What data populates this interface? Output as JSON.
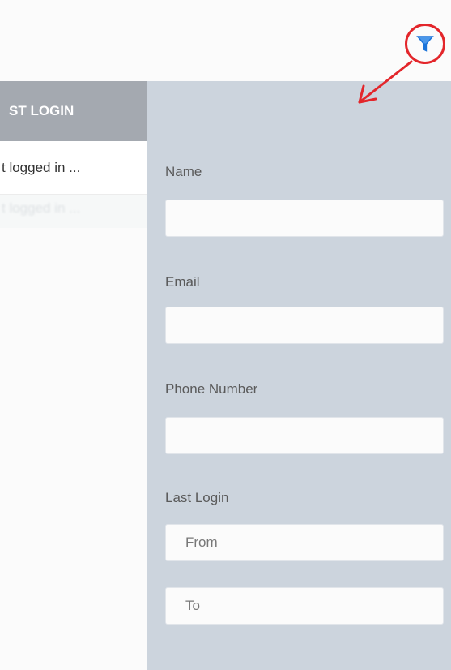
{
  "table": {
    "header_label": "ST LOGIN",
    "rows": [
      {
        "last_login": "t logged in ..."
      },
      {
        "last_login": "t logged in ..."
      }
    ]
  },
  "filter_panel": {
    "fields": [
      {
        "label": "Name",
        "value": "",
        "placeholder": ""
      },
      {
        "label": "Email",
        "value": "",
        "placeholder": ""
      },
      {
        "label": "Phone Number",
        "value": "",
        "placeholder": ""
      }
    ],
    "last_login": {
      "label": "Last Login",
      "from_placeholder": "From",
      "to_placeholder": "To"
    }
  },
  "icons": {
    "filter": "filter-icon",
    "annotation_circle": "red-circle-highlight",
    "annotation_arrow": "red-arrow"
  },
  "colors": {
    "filter_icon": "#1a73d9",
    "annotation": "#e3262b",
    "panel_bg": "#ccd4dd",
    "header_bg": "#a4a9b0"
  }
}
